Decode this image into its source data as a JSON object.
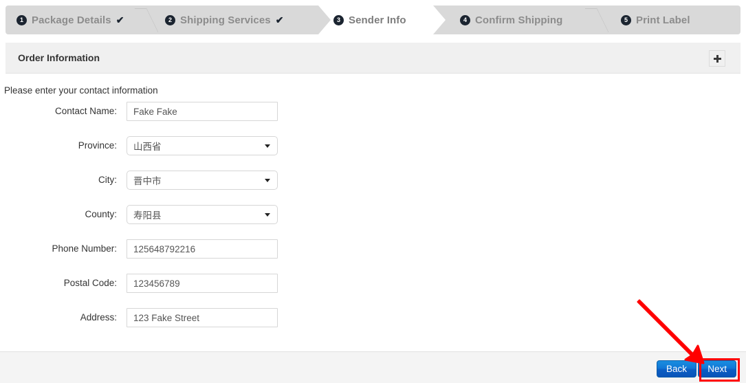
{
  "wizard": {
    "steps": [
      {
        "number": "1",
        "label": "Package Details",
        "completed": true,
        "active": false,
        "check": "✔"
      },
      {
        "number": "2",
        "label": "Shipping Services",
        "completed": true,
        "active": false,
        "check": "✔"
      },
      {
        "number": "3",
        "label": "Sender Info",
        "completed": false,
        "active": true,
        "check": ""
      },
      {
        "number": "4",
        "label": "Confirm Shipping",
        "completed": false,
        "active": false,
        "check": ""
      },
      {
        "number": "5",
        "label": "Print Label",
        "completed": false,
        "active": false,
        "check": ""
      }
    ]
  },
  "panel": {
    "title": "Order Information",
    "expand_icon": "plus-icon"
  },
  "form": {
    "intro": "Please enter your contact information",
    "fields": [
      {
        "label": "Contact Name:",
        "type": "text",
        "value": "Fake Fake",
        "placeholder": ""
      },
      {
        "label": "Province:",
        "type": "select",
        "value": "山西省",
        "placeholder": ""
      },
      {
        "label": "City:",
        "type": "select",
        "value": "晋中市",
        "placeholder": ""
      },
      {
        "label": "County:",
        "type": "select",
        "value": "寿阳县",
        "placeholder": ""
      },
      {
        "label": "Phone Number:",
        "type": "text",
        "value": "125648792216",
        "placeholder": ""
      },
      {
        "label": "Postal Code:",
        "type": "text",
        "value": "123456789",
        "placeholder": ""
      },
      {
        "label": "Address:",
        "type": "text",
        "value": "123 Fake Street",
        "placeholder": ""
      }
    ]
  },
  "footer": {
    "back_label": "Back",
    "next_label": "Next"
  },
  "annotation": {
    "arrow_color": "#ff0000",
    "highlight_color": "#ff0000",
    "points_to": "next-button"
  },
  "colors": {
    "wizard_bg": "#d9d9d9",
    "active_step_bg": "#ffffff",
    "badge_bg": "#1b2430",
    "step_label": "#8c8c8c",
    "panel_header_bg": "#f0f0f0",
    "button_blue": "#1177d6",
    "footer_bg": "#f4f4f4"
  }
}
